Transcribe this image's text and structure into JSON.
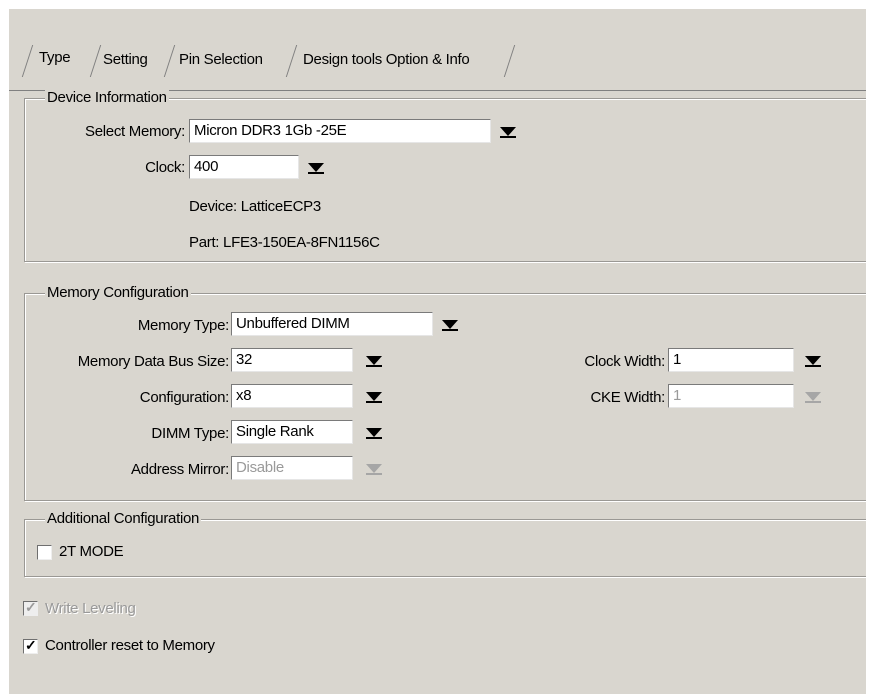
{
  "tabs": [
    {
      "label": "Type"
    },
    {
      "label": "Setting"
    },
    {
      "label": "Pin Selection"
    },
    {
      "label": "Design tools Option & Info"
    }
  ],
  "device_info": {
    "title": "Device Information",
    "select_memory_label": "Select Memory:",
    "select_memory_value": "Micron DDR3 1Gb -25E",
    "clock_label": "Clock:",
    "clock_value": "400",
    "device_text": "Device: LatticeECP3",
    "part_text": "Part: LFE3-150EA-8FN1156C"
  },
  "memory_config": {
    "title": "Memory Configuration",
    "memory_type_label": "Memory Type:",
    "memory_type_value": "Unbuffered DIMM",
    "bus_size_label": "Memory Data Bus Size:",
    "bus_size_value": "32",
    "configuration_label": "Configuration:",
    "configuration_value": "x8",
    "dimm_type_label": "DIMM Type:",
    "dimm_type_value": "Single Rank",
    "address_mirror_label": "Address Mirror:",
    "address_mirror_value": "Disable",
    "clock_width_label": "Clock Width:",
    "clock_width_value": "1",
    "cke_width_label": "CKE Width:",
    "cke_width_value": "1"
  },
  "additional_config": {
    "title": "Additional Configuration",
    "two_t_mode_label": "2T MODE",
    "two_t_mode_checked": false
  },
  "write_leveling": {
    "label": "Write Leveling",
    "checked": true,
    "enabled": false
  },
  "controller_reset": {
    "label": "Controller reset to Memory",
    "checked": true
  }
}
